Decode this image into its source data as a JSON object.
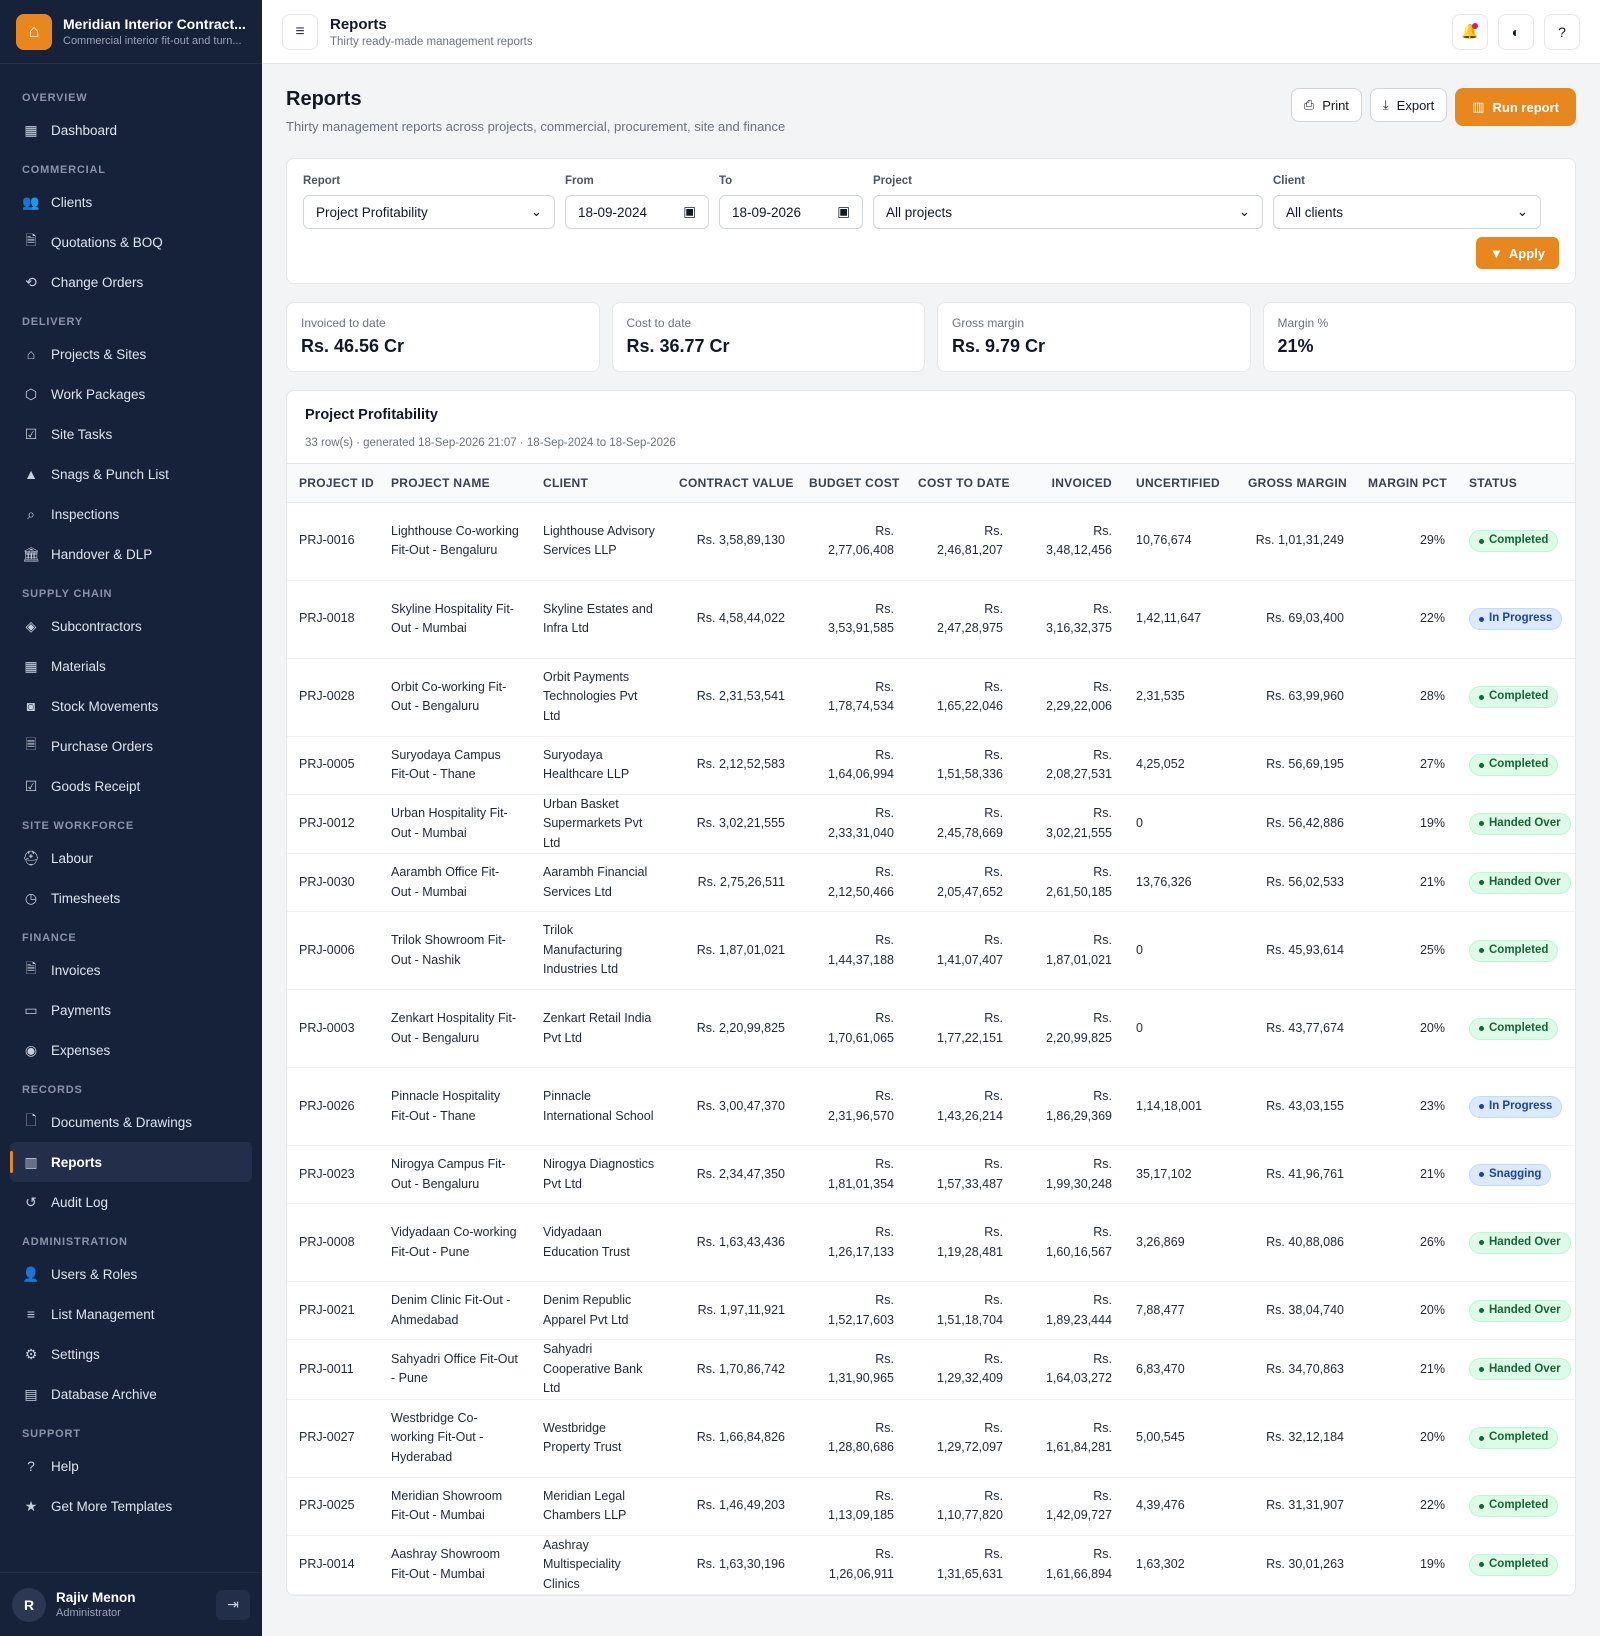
{
  "brand": {
    "name": "Meridian Interior Contract...",
    "subtitle": "Commercial interior fit-out and turn..."
  },
  "nav": [
    {
      "section": "OVERVIEW",
      "items": [
        {
          "label": "Dashboard",
          "icon": "dashboard-icon",
          "glyph": "▦"
        }
      ]
    },
    {
      "section": "COMMERCIAL",
      "items": [
        {
          "label": "Clients",
          "icon": "clients-icon",
          "glyph": "👥"
        },
        {
          "label": "Quotations & BOQ",
          "icon": "quotation-icon",
          "glyph": "🗎"
        },
        {
          "label": "Change Orders",
          "icon": "change-orders-icon",
          "glyph": "⟲"
        }
      ]
    },
    {
      "section": "DELIVERY",
      "items": [
        {
          "label": "Projects & Sites",
          "icon": "home-icon",
          "glyph": "⌂"
        },
        {
          "label": "Work Packages",
          "icon": "package-icon",
          "glyph": "⬡"
        },
        {
          "label": "Site Tasks",
          "icon": "clipboard-icon",
          "glyph": "☑"
        },
        {
          "label": "Snags & Punch List",
          "icon": "warning-icon",
          "glyph": "▲"
        },
        {
          "label": "Inspections",
          "icon": "search-icon",
          "glyph": "⌕"
        },
        {
          "label": "Handover & DLP",
          "icon": "building-icon",
          "glyph": "🏛"
        }
      ]
    },
    {
      "section": "SUPPLY CHAIN",
      "items": [
        {
          "label": "Subcontractors",
          "icon": "layers-icon",
          "glyph": "◈"
        },
        {
          "label": "Materials",
          "icon": "grid-icon",
          "glyph": "▦"
        },
        {
          "label": "Stock Movements",
          "icon": "camera-icon",
          "glyph": "◙"
        },
        {
          "label": "Purchase Orders",
          "icon": "purchase-order-icon",
          "glyph": "🗏"
        },
        {
          "label": "Goods Receipt",
          "icon": "check-square-icon",
          "glyph": "☑"
        }
      ]
    },
    {
      "section": "SITE WORKFORCE",
      "items": [
        {
          "label": "Labour",
          "icon": "labour-icon",
          "glyph": "⛑"
        },
        {
          "label": "Timesheets",
          "icon": "clock-icon",
          "glyph": "◷"
        }
      ]
    },
    {
      "section": "FINANCE",
      "items": [
        {
          "label": "Invoices",
          "icon": "invoice-icon",
          "glyph": "🗎"
        },
        {
          "label": "Payments",
          "icon": "card-icon",
          "glyph": "▭"
        },
        {
          "label": "Expenses",
          "icon": "coin-icon",
          "glyph": "◉"
        }
      ]
    },
    {
      "section": "RECORDS",
      "items": [
        {
          "label": "Documents & Drawings",
          "icon": "document-icon",
          "glyph": "🗋"
        },
        {
          "label": "Reports",
          "icon": "chart-icon",
          "glyph": "▥",
          "active": true
        },
        {
          "label": "Audit Log",
          "icon": "history-icon",
          "glyph": "↺"
        }
      ]
    },
    {
      "section": "ADMINISTRATION",
      "items": [
        {
          "label": "Users & Roles",
          "icon": "user-icon",
          "glyph": "👤"
        },
        {
          "label": "List Management",
          "icon": "list-icon",
          "glyph": "≡"
        },
        {
          "label": "Settings",
          "icon": "gear-icon",
          "glyph": "⚙"
        },
        {
          "label": "Database Archive",
          "icon": "archive-icon",
          "glyph": "▤"
        }
      ]
    },
    {
      "section": "SUPPORT",
      "items": [
        {
          "label": "Help",
          "icon": "help-icon",
          "glyph": "?"
        },
        {
          "label": "Get More Templates",
          "icon": "star-icon",
          "glyph": "★"
        }
      ]
    }
  ],
  "user": {
    "initial": "R",
    "name": "Rajiv Menon",
    "role": "Administrator"
  },
  "topbar": {
    "title": "Reports",
    "subtitle": "Thirty ready-made management reports"
  },
  "page": {
    "title": "Reports",
    "subtitle": "Thirty management reports across projects, commercial, procurement, site and finance",
    "print_label": "Print",
    "export_label": "Export",
    "run_label": "Run report"
  },
  "filters": {
    "report_label": "Report",
    "report_value": "Project Profitability",
    "from_label": "From",
    "from_value": "18-09-2024",
    "to_label": "To",
    "to_value": "18-09-2026",
    "project_label": "Project",
    "project_value": "All projects",
    "client_label": "Client",
    "client_value": "All clients",
    "apply_label": "Apply"
  },
  "kpis": [
    {
      "label": "Invoiced to date",
      "value": "Rs. 46.56 Cr"
    },
    {
      "label": "Cost to date",
      "value": "Rs. 36.77 Cr"
    },
    {
      "label": "Gross margin",
      "value": "Rs. 9.79 Cr"
    },
    {
      "label": "Margin %",
      "value": "21%"
    }
  ],
  "report": {
    "title": "Project Profitability",
    "meta": "33 row(s) · generated 18-Sep-2026 21:07 · 18-Sep-2024 to 18-Sep-2026",
    "columns": [
      "PROJECT ID",
      "PROJECT NAME",
      "CLIENT",
      "CONTRACT VALUE",
      "BUDGET COST",
      "COST TO DATE",
      "INVOICED",
      "UNCERTIFIED",
      "GROSS MARGIN",
      "MARGIN PCT",
      "STATUS"
    ],
    "rows": [
      [
        "PRJ-0016",
        "Lighthouse Co-working Fit-Out - Bengaluru",
        "Lighthouse Advisory Services LLP",
        "Rs. 3,58,89,130",
        "Rs. 2,77,06,408",
        "Rs. 2,46,81,207",
        "Rs. 3,48,12,456",
        "10,76,674",
        "Rs. 1,01,31,249",
        "29%",
        "Completed"
      ],
      [
        "PRJ-0018",
        "Skyline Hospitality Fit-Out - Mumbai",
        "Skyline Estates and Infra Ltd",
        "Rs. 4,58,44,022",
        "Rs. 3,53,91,585",
        "Rs. 2,47,28,975",
        "Rs. 3,16,32,375",
        "1,42,11,647",
        "Rs. 69,03,400",
        "22%",
        "In Progress"
      ],
      [
        "PRJ-0028",
        "Orbit Co-working Fit-Out - Bengaluru",
        "Orbit Payments Technologies Pvt Ltd",
        "Rs. 2,31,53,541",
        "Rs. 1,78,74,534",
        "Rs. 1,65,22,046",
        "Rs. 2,29,22,006",
        "2,31,535",
        "Rs. 63,99,960",
        "28%",
        "Completed"
      ],
      [
        "PRJ-0005",
        "Suryodaya Campus Fit-Out - Thane",
        "Suryodaya Healthcare LLP",
        "Rs. 2,12,52,583",
        "Rs. 1,64,06,994",
        "Rs. 1,51,58,336",
        "Rs. 2,08,27,531",
        "4,25,052",
        "Rs. 56,69,195",
        "27%",
        "Completed"
      ],
      [
        "PRJ-0012",
        "Urban Hospitality Fit-Out - Mumbai",
        "Urban Basket Supermarkets Pvt Ltd",
        "Rs. 3,02,21,555",
        "Rs. 2,33,31,040",
        "Rs. 2,45,78,669",
        "Rs. 3,02,21,555",
        "0",
        "Rs. 56,42,886",
        "19%",
        "Handed Over"
      ],
      [
        "PRJ-0030",
        "Aarambh Office Fit-Out - Mumbai",
        "Aarambh Financial Services Ltd",
        "Rs. 2,75,26,511",
        "Rs. 2,12,50,466",
        "Rs. 2,05,47,652",
        "Rs. 2,61,50,185",
        "13,76,326",
        "Rs. 56,02,533",
        "21%",
        "Handed Over"
      ],
      [
        "PRJ-0006",
        "Trilok Showroom Fit-Out - Nashik",
        "Trilok Manufacturing Industries Ltd",
        "Rs. 1,87,01,021",
        "Rs. 1,44,37,188",
        "Rs. 1,41,07,407",
        "Rs. 1,87,01,021",
        "0",
        "Rs. 45,93,614",
        "25%",
        "Completed"
      ],
      [
        "PRJ-0003",
        "Zenkart Hospitality Fit-Out - Bengaluru",
        "Zenkart Retail India Pvt Ltd",
        "Rs. 2,20,99,825",
        "Rs. 1,70,61,065",
        "Rs. 1,77,22,151",
        "Rs. 2,20,99,825",
        "0",
        "Rs. 43,77,674",
        "20%",
        "Completed"
      ],
      [
        "PRJ-0026",
        "Pinnacle Hospitality Fit-Out - Thane",
        "Pinnacle International School",
        "Rs. 3,00,47,370",
        "Rs. 2,31,96,570",
        "Rs. 1,43,26,214",
        "Rs. 1,86,29,369",
        "1,14,18,001",
        "Rs. 43,03,155",
        "23%",
        "In Progress"
      ],
      [
        "PRJ-0023",
        "Nirogya Campus Fit-Out - Bengaluru",
        "Nirogya Diagnostics Pvt Ltd",
        "Rs. 2,34,47,350",
        "Rs. 1,81,01,354",
        "Rs. 1,57,33,487",
        "Rs. 1,99,30,248",
        "35,17,102",
        "Rs. 41,96,761",
        "21%",
        "Snagging"
      ],
      [
        "PRJ-0008",
        "Vidyadaan Co-working Fit-Out - Pune",
        "Vidyadaan Education Trust",
        "Rs. 1,63,43,436",
        "Rs. 1,26,17,133",
        "Rs. 1,19,28,481",
        "Rs. 1,60,16,567",
        "3,26,869",
        "Rs. 40,88,086",
        "26%",
        "Handed Over"
      ],
      [
        "PRJ-0021",
        "Denim Clinic Fit-Out - Ahmedabad",
        "Denim Republic Apparel Pvt Ltd",
        "Rs. 1,97,11,921",
        "Rs. 1,52,17,603",
        "Rs. 1,51,18,704",
        "Rs. 1,89,23,444",
        "7,88,477",
        "Rs. 38,04,740",
        "20%",
        "Handed Over"
      ],
      [
        "PRJ-0011",
        "Sahyadri Office Fit-Out - Pune",
        "Sahyadri Cooperative Bank Ltd",
        "Rs. 1,70,86,742",
        "Rs. 1,31,90,965",
        "Rs. 1,29,32,409",
        "Rs. 1,64,03,272",
        "6,83,470",
        "Rs. 34,70,863",
        "21%",
        "Handed Over"
      ],
      [
        "PRJ-0027",
        "Westbridge Co-working Fit-Out - Hyderabad",
        "Westbridge Property Trust",
        "Rs. 1,66,84,826",
        "Rs. 1,28,80,686",
        "Rs. 1,29,72,097",
        "Rs. 1,61,84,281",
        "5,00,545",
        "Rs. 32,12,184",
        "20%",
        "Completed"
      ],
      [
        "PRJ-0025",
        "Meridian Showroom Fit-Out - Mumbai",
        "Meridian Legal Chambers LLP",
        "Rs. 1,46,49,203",
        "Rs. 1,13,09,185",
        "Rs. 1,10,77,820",
        "Rs. 1,42,09,727",
        "4,39,476",
        "Rs. 31,31,907",
        "22%",
        "Completed"
      ],
      [
        "PRJ-0014",
        "Aashray Showroom Fit-Out - Mumbai",
        "Aashray Multispeciality Clinics",
        "Rs. 1,63,30,196",
        "Rs. 1,26,06,911",
        "Rs. 1,31,65,631",
        "Rs. 1,61,66,894",
        "1,63,302",
        "Rs. 30,01,263",
        "19%",
        "Completed"
      ]
    ]
  },
  "colors": {
    "accent": "#e8871e",
    "sidebar": "#16213a",
    "status_green": "#166534",
    "status_blue": "#1e40af"
  }
}
